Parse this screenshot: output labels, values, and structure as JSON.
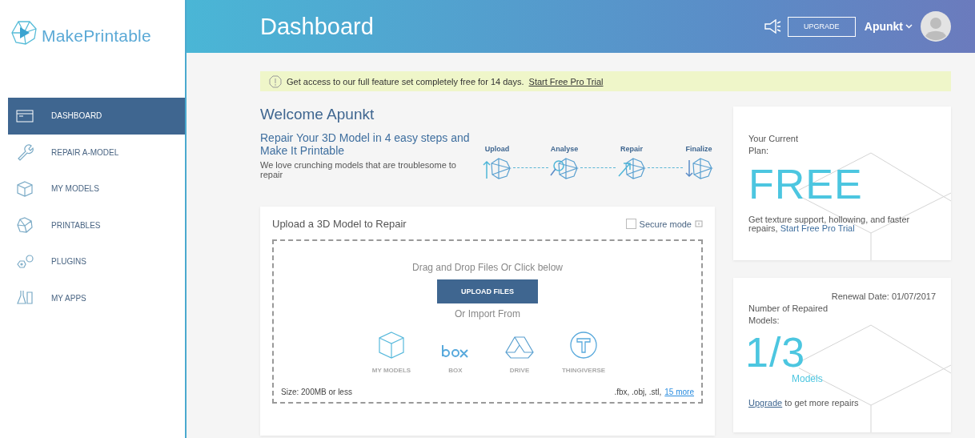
{
  "brand": {
    "name": "MakePrintable"
  },
  "sidebar": {
    "items": [
      {
        "label": "DASHBOARD",
        "selected": true
      },
      {
        "label": "REPAIR A-MODEL",
        "selected": false
      },
      {
        "label": "MY MODELS",
        "selected": false
      },
      {
        "label": "PRINTABLES",
        "selected": false
      },
      {
        "label": "PLUGINS",
        "selected": false
      },
      {
        "label": "MY APPS",
        "selected": false
      }
    ]
  },
  "header": {
    "title": "Dashboard",
    "upgrade": "UPGRADE",
    "user": "Apunkt"
  },
  "notice": {
    "text": "Get access to our full feature set completely free for 14 days.",
    "link": "Start Free Pro Trial"
  },
  "welcome": {
    "title": "Welcome Apunkt",
    "subtitle": "Repair Your 3D Model in 4 easy steps and Make It Printable",
    "description": "We love crunching models that are troublesome to repair"
  },
  "steps": [
    {
      "label": "Upload"
    },
    {
      "label": "Analyse"
    },
    {
      "label": "Repair"
    },
    {
      "label": "Finalize"
    }
  ],
  "upload": {
    "title": "Upload a 3D Model to Repair",
    "secure_mode": {
      "label": "Secure mode",
      "checked": false
    },
    "drop_hint": "Drag and Drop Files Or Click below",
    "button": "UPLOAD FILES",
    "import_label": "Or Import From",
    "sources": [
      {
        "label": "MY MODELS"
      },
      {
        "label": "BOX"
      },
      {
        "label": "DRIVE"
      },
      {
        "label": "THINGIVERSE"
      }
    ],
    "size_note": "Size: 200MB or less",
    "formats": ".fbx, .obj, .stl,",
    "more_link": "15 more"
  },
  "plan": {
    "label": "Your Current Plan:",
    "value": "FREE",
    "note": "Get texture support, hollowing, and faster repairs,",
    "link": "Start Free Pro Trial"
  },
  "usage": {
    "renewal": "Renewal Date: 01/07/2017",
    "label": "Number of Repaired Models:",
    "value": "1/3",
    "unit": "Models",
    "link": "Upgrade",
    "note": "to get more repairs"
  }
}
